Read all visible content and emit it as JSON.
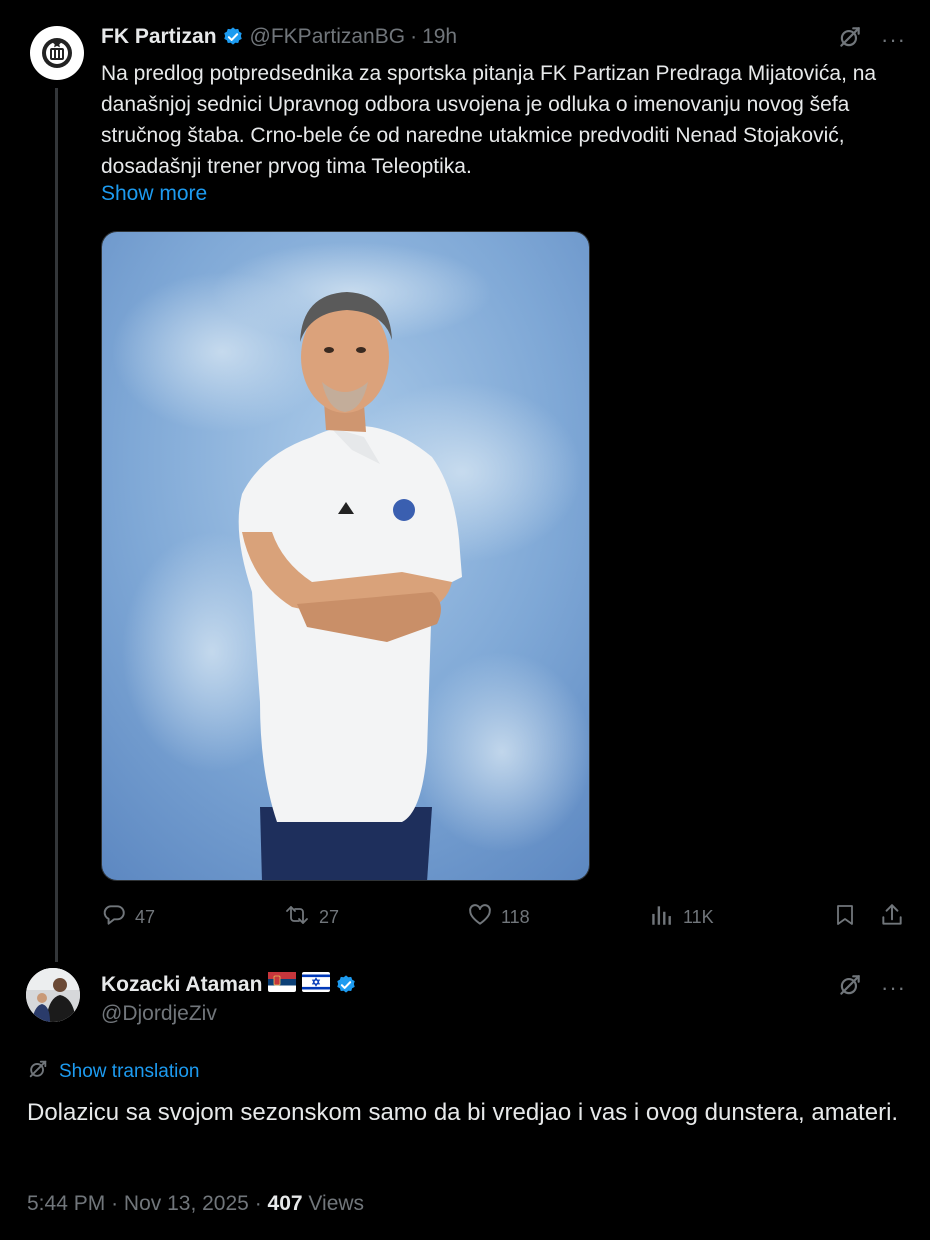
{
  "tweet": {
    "author_name": "FK Partizan",
    "author_handle": "@FKPartizanBG",
    "separator": "·",
    "time": "19h",
    "text": "Na predlog potpredsednika za sportska pitanja FK Partizan Predraga Mijatovića, na današnjoj sednici Upravnog odbora usvojena je odluka o imenovanju novog šefa stručnog štaba. Crno-bele će od naredne utakmice predvoditi Nenad Stojaković, dosadašnji trener prvog tima Teleoptika.",
    "show_more": "Show more",
    "stats": {
      "replies": "47",
      "reposts": "27",
      "likes": "118",
      "views": "11K"
    }
  },
  "reply": {
    "author_name": "Kozacki Ataman",
    "author_handle": "@DjordjeZiv",
    "show_translation": "Show translation",
    "text": "Dolazicu sa svojom sezonskom samo da bi vredjao i vas i ovog dunstera, amateri.",
    "time": "5:44 PM",
    "date": "Nov 13, 2025",
    "views_count": "407",
    "views_label": "Views",
    "separator": "·"
  },
  "icons": {
    "verified": "verified-badge-icon",
    "grok": "grok-icon",
    "more": "more-icon",
    "reply": "reply-icon",
    "repost": "repost-icon",
    "like": "like-icon",
    "views": "views-icon",
    "bookmark": "bookmark-icon",
    "share": "share-icon",
    "translate": "translate-icon",
    "flag_serbia": "serbia-flag-icon",
    "flag_israel": "israel-flag-icon"
  },
  "colors": {
    "background": "#000000",
    "text": "#e7e9ea",
    "secondary": "#71767b",
    "link": "#1d9bf0",
    "verified": "#1d9bf0"
  }
}
